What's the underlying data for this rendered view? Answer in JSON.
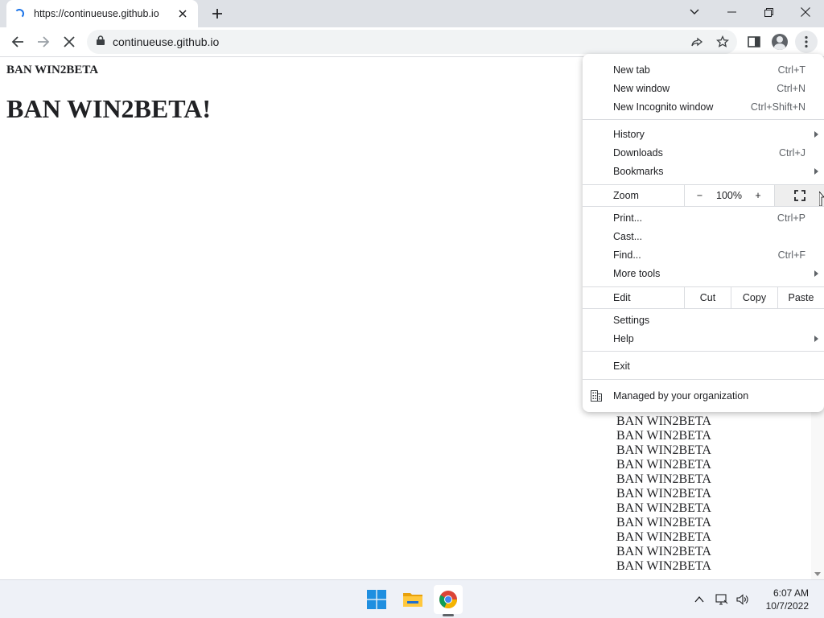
{
  "browser": {
    "tab_title": "https://continueuse.github.io",
    "url": "continueuse.github.io"
  },
  "page": {
    "heading_small": "BAN WIN2BETA",
    "heading_big": "BAN WIN2BETA!",
    "repeated_lines": [
      "BAN WIN2BETA",
      "BAN WIN2BETA",
      "BAN WIN2BETA",
      "BAN WIN2BETA",
      "BAN WIN2BETA",
      "BAN WIN2BETA",
      "BAN WIN2BETA",
      "BAN WIN2BETA",
      "BAN WIN2BETA",
      "BAN WIN2BETA",
      "BAN WIN2BETA",
      "BAN WIN2BETA"
    ]
  },
  "menu": {
    "new_tab": {
      "label": "New tab",
      "shortcut": "Ctrl+T"
    },
    "new_window": {
      "label": "New window",
      "shortcut": "Ctrl+N"
    },
    "new_incognito": {
      "label": "New Incognito window",
      "shortcut": "Ctrl+Shift+N"
    },
    "history": {
      "label": "History"
    },
    "downloads": {
      "label": "Downloads",
      "shortcut": "Ctrl+J"
    },
    "bookmarks": {
      "label": "Bookmarks"
    },
    "zoom": {
      "label": "Zoom",
      "minus": "−",
      "value": "100%",
      "plus": "+"
    },
    "print": {
      "label": "Print...",
      "shortcut": "Ctrl+P"
    },
    "cast": {
      "label": "Cast..."
    },
    "find": {
      "label": "Find...",
      "shortcut": "Ctrl+F"
    },
    "more_tools": {
      "label": "More tools"
    },
    "edit": {
      "label": "Edit",
      "cut": "Cut",
      "copy": "Copy",
      "paste": "Paste"
    },
    "settings": {
      "label": "Settings"
    },
    "help": {
      "label": "Help"
    },
    "exit": {
      "label": "Exit"
    },
    "managed": {
      "label": "Managed by your organization"
    }
  },
  "taskbar": {
    "time": "6:07 AM",
    "date": "10/7/2022"
  },
  "colors": {
    "accent": "#1a73e8",
    "tabstrip": "#dee1e6",
    "taskbar": "#eef1f7"
  }
}
